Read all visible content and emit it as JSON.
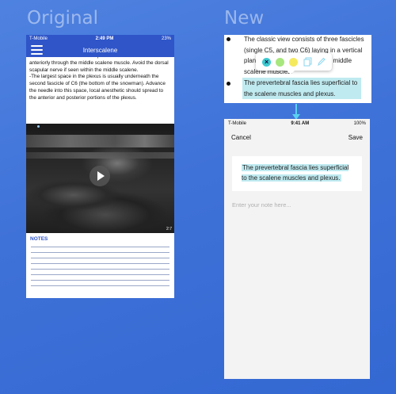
{
  "headings": {
    "original": "Original",
    "new": "New"
  },
  "original": {
    "status": {
      "carrier": "T-Mobile",
      "time": "2:49 PM",
      "battery": "23%"
    },
    "nav_title": "Interscalene",
    "body": [
      "-Advance the needle from the posterior side of the neck anteriorly through the middle scalene muscle. Avoid the dorsal scapular nerve if seen within the middle scalene.",
      "-The largest space in the plexus is usually underneath the second fascicle of C6 (the bottom of the snowman). Advance the needle into this space, local anesthetic should spread to the anterior and posterior portions of the plexus."
    ],
    "video_time": "2:7",
    "notes_label": "NOTES"
  },
  "snippet": {
    "bullet1": "The classic view consists of three fascicles (single C5, and two C6) laying in a vertical plane between the anterior and middle scalene muscles.",
    "bullet2": "The prevertebral fascia lies superficial to the scalene muscles and plexus.",
    "close_glyph": "×"
  },
  "new_phone": {
    "status": {
      "carrier": "T-Mobile",
      "time": "9:41 AM",
      "battery": "100%"
    },
    "cancel_label": "Cancel",
    "save_label": "Save",
    "quote": "The prevertebral fascia lies superficial to the scalene muscles and plexus.",
    "note_placeholder": "Enter your note here..."
  },
  "colors": {
    "brand_blue": "#2f55c8",
    "highlight": "#bfeaf0",
    "teal": "#3ec9cf",
    "green": "#a8e77d",
    "yellow": "#f5ea5e",
    "arrow": "#5ad0f0"
  },
  "icons": [
    "hamburger-menu-icon",
    "play-icon",
    "close-icon",
    "copy-icon",
    "pencil-icon",
    "wifi-icon",
    "battery-icon"
  ]
}
